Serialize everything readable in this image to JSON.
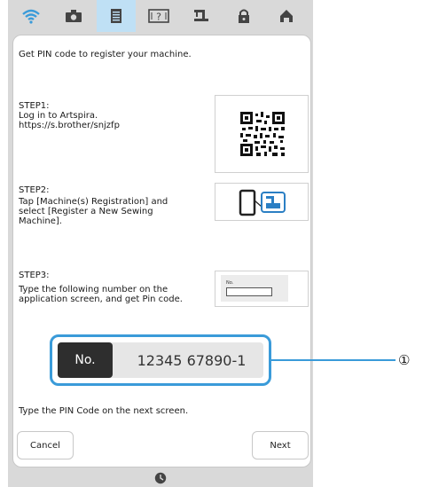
{
  "intro": "Get PIN code to register your machine.",
  "step1": {
    "title": "STEP1:",
    "line1": "Log in to Artspira.",
    "line2": "https://s.brother/snjzfp"
  },
  "step2": {
    "title": "STEP2:",
    "line1": "Tap [Machine(s) Registration] and",
    "line2": "select [Register a New Sewing",
    "line3": "Machine]."
  },
  "step3": {
    "title": "STEP3:",
    "line1": "Type the following number on the",
    "line2": "application screen, and get Pin code.",
    "thumb_label": "No."
  },
  "pin": {
    "label": "No.",
    "value": "12345 67890-1"
  },
  "footer_note": "Type the PIN Code on the next screen.",
  "buttons": {
    "cancel": "Cancel",
    "next": "Next"
  },
  "callout": "①",
  "icons": [
    "wifi-icon",
    "camera-icon",
    "document-icon",
    "help-icon",
    "machine-icon",
    "lock-icon",
    "home-icon",
    "clock-icon"
  ],
  "colors": {
    "accent": "#3a9bd9",
    "active_tab": "#bfe0f5",
    "chrome": "#d9d9d9"
  }
}
